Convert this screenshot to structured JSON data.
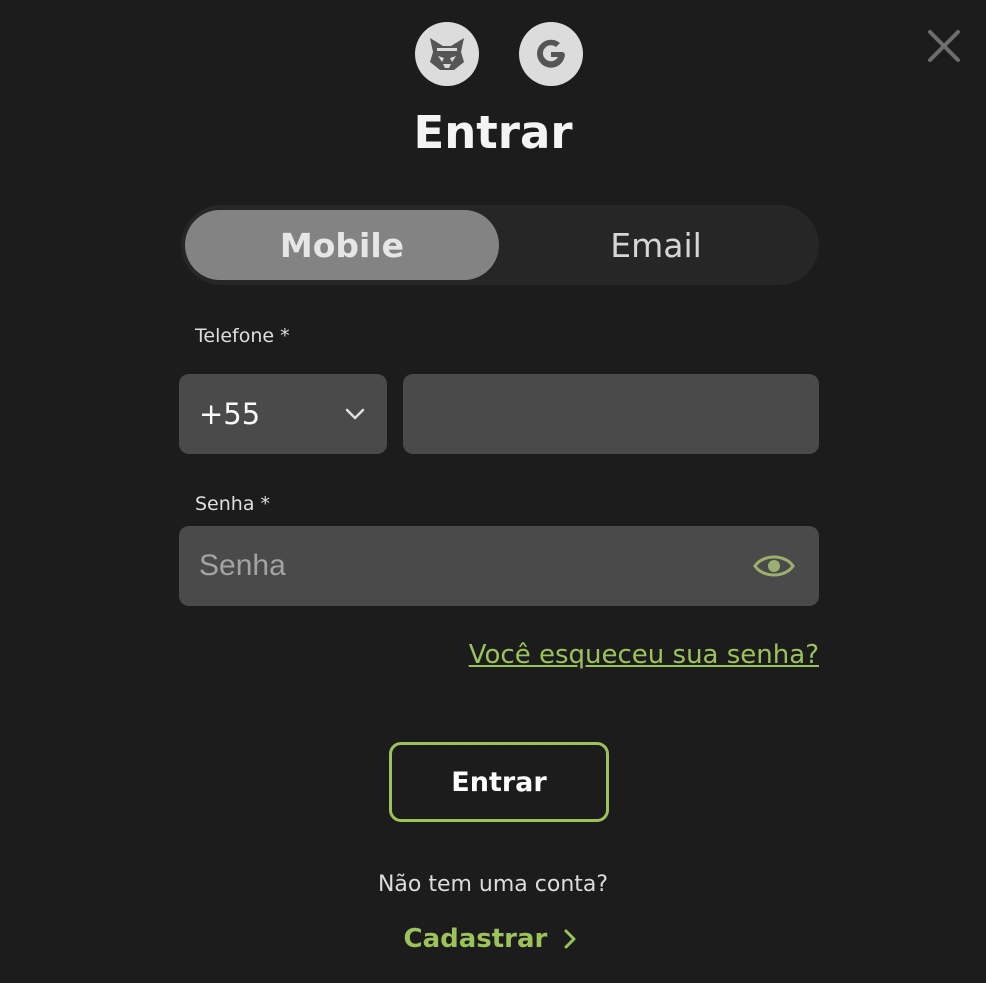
{
  "social": {
    "metamask_icon": "metamask-fox-icon",
    "google_icon": "google-g-icon"
  },
  "dialog": {
    "title": "Entrar",
    "close_icon": "close-icon"
  },
  "tabs": [
    {
      "label": "Mobile",
      "active": true
    },
    {
      "label": "Email",
      "active": false
    }
  ],
  "form": {
    "phone_label": "Telefone *",
    "country_code": "+55",
    "phone_value": "",
    "password_label": "Senha *",
    "password_placeholder": "Senha",
    "forgot_link": "Você esqueceu sua senha?",
    "submit_label": "Entrar"
  },
  "footer": {
    "no_account_text": "Não tem uma conta?",
    "signup_label": "Cadastrar"
  },
  "colors": {
    "background": "#1c1c1c",
    "accent": "#9cc25a",
    "input_bg": "#4a4a4a",
    "active_tab": "#838383"
  }
}
